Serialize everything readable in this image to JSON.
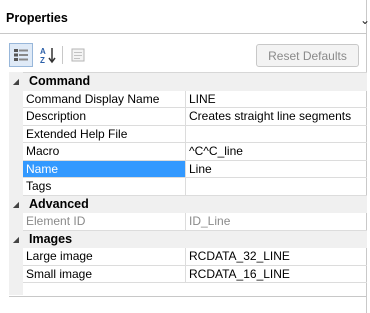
{
  "panel": {
    "title": "Properties",
    "title_pin_glyph": "⌄"
  },
  "toolbar": {
    "categorized_icon": "categorized-icon",
    "alphabetical_icon": "alphabetical-sort-icon",
    "property_pages_icon": "property-pages-icon",
    "reset_label": "Reset Defaults"
  },
  "categories": [
    {
      "label": "Command",
      "rows": [
        {
          "name": "Command Display Name",
          "value": "LINE"
        },
        {
          "name": "Description",
          "value": "Creates straight line segments"
        },
        {
          "name": "Extended Help File",
          "value": ""
        },
        {
          "name": "Macro",
          "value": "^C^C_line"
        },
        {
          "name": "Name",
          "value": "Line",
          "selected": true
        },
        {
          "name": "Tags",
          "value": ""
        }
      ]
    },
    {
      "label": "Advanced",
      "rows": [
        {
          "name": "Element ID",
          "value": "ID_Line",
          "readonly": true
        }
      ]
    },
    {
      "label": "Images",
      "rows": [
        {
          "name": "Large image",
          "value": "RCDATA_32_LINE"
        },
        {
          "name": "Small image",
          "value": "RCDATA_16_LINE"
        }
      ]
    }
  ],
  "colors": {
    "selection": "#3399ff",
    "category_bg": "#f0f0f0",
    "readonly_text": "#8a8a8a"
  }
}
